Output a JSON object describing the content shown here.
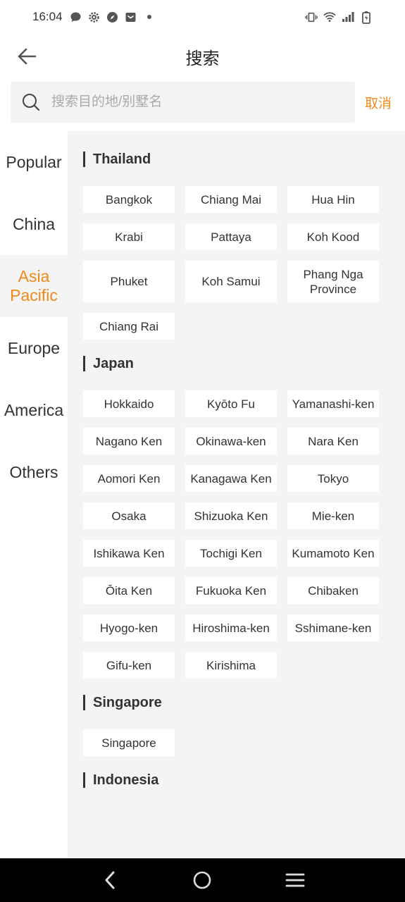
{
  "status_bar": {
    "time": "16:04"
  },
  "header": {
    "title": "搜索"
  },
  "search": {
    "placeholder": "搜索目的地/别墅名",
    "value": "",
    "cancel_label": "取消"
  },
  "sidebar": {
    "items": [
      {
        "label": "Popular",
        "active": false
      },
      {
        "label": "China",
        "active": false
      },
      {
        "label": "Asia Pacific",
        "active": true
      },
      {
        "label": "Europe",
        "active": false
      },
      {
        "label": "America",
        "active": false
      },
      {
        "label": "Others",
        "active": false
      }
    ]
  },
  "groups": [
    {
      "title": "Thailand",
      "cities": [
        "Bangkok",
        "Chiang Mai",
        "Hua Hin",
        "Krabi",
        "Pattaya",
        "Koh Kood",
        "Phuket",
        "Koh Samui",
        "Phang Nga Province",
        "Chiang Rai"
      ]
    },
    {
      "title": "Japan",
      "cities": [
        "Hokkaido",
        "Kyōto Fu",
        "Yamanashi-ken",
        "Nagano Ken",
        "Okinawa-ken",
        "Nara Ken",
        "Aomori Ken",
        "Kanagawa Ken",
        "Tokyo",
        "Osaka",
        "Shizuoka Ken",
        "Mie-ken",
        "Ishikawa Ken",
        "Tochigi Ken",
        "Kumamoto Ken",
        "Ōita Ken",
        "Fukuoka Ken",
        "Chibaken",
        "Hyogo-ken",
        "Hiroshima-ken",
        "Sshimane-ken",
        "Gifu-ken",
        "Kirishima"
      ]
    },
    {
      "title": "Singapore",
      "cities": [
        "Singapore"
      ]
    },
    {
      "title": "Indonesia",
      "cities": []
    }
  ],
  "colors": {
    "accent": "#ef8a1a",
    "content_bg": "#f4f4f4"
  }
}
